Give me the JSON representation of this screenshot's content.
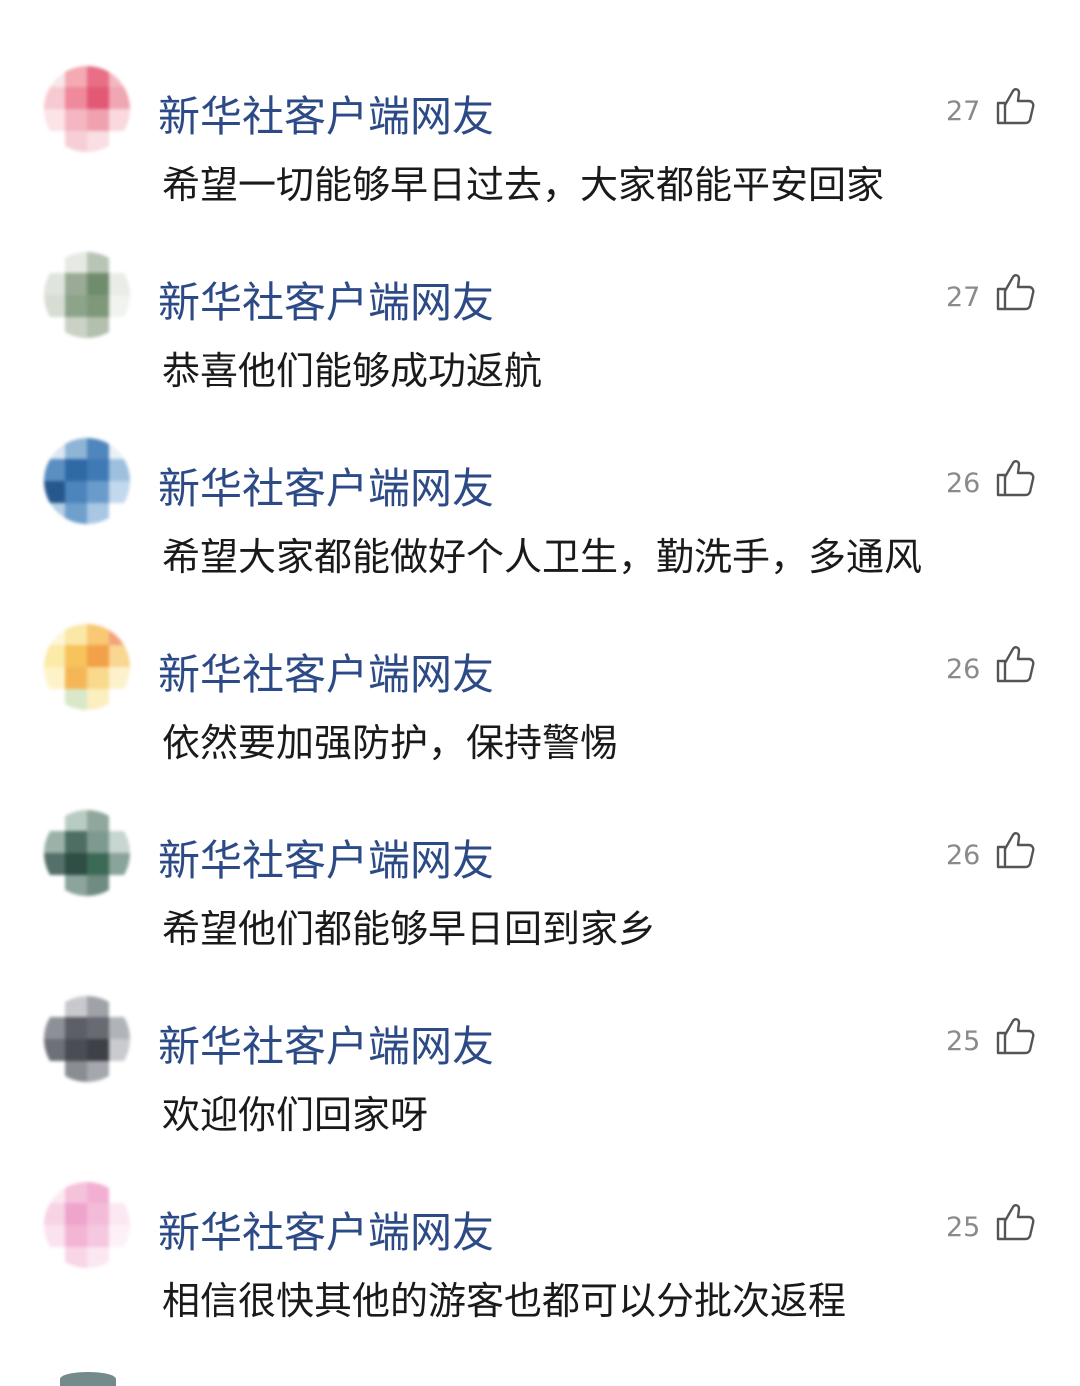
{
  "comments": [
    {
      "username": "新华社客户端网友",
      "text": "希望一切能够早日过去，大家都能平安回家",
      "likes": "27",
      "avatar_colors": [
        "#f8e7e8",
        "#f4a9b3",
        "#e86f85",
        "#f3b7c0",
        "#f7c9d0",
        "#ee8a9c",
        "#e25875",
        "#f0a6b3",
        "#fbe3e6",
        "#f5b6c1",
        "#f0a1b0",
        "#f9d9de",
        "#ffffff",
        "#f6cfd6",
        "#f9dee3",
        "#ffffff"
      ]
    },
    {
      "username": "新华社客户端网友",
      "text": "恭喜他们能够成功返航",
      "likes": "27",
      "avatar_colors": [
        "#ffffff",
        "#e6e9e4",
        "#b8c4b4",
        "#ffffff",
        "#dfe4dc",
        "#9aaa96",
        "#6f8c6d",
        "#e9ece7",
        "#d7ddd3",
        "#8da38a",
        "#7e9879",
        "#f1f3ef",
        "#ffffff",
        "#c9d2c4",
        "#b3c0ae",
        "#ffffff"
      ]
    },
    {
      "username": "新华社客户端网友",
      "text": "希望大家都能做好个人卫生，勤洗手，多通风",
      "likes": "26",
      "avatar_colors": [
        "#dbe7f2",
        "#8fb4d6",
        "#4f86bd",
        "#e9f1f8",
        "#5b8fc2",
        "#2f6aa6",
        "#3f7ab4",
        "#9dc0df",
        "#26588e",
        "#4c84bc",
        "#6a9ccb",
        "#c2d8ec",
        "#b5cde5",
        "#6f9fcc",
        "#a9c7e3",
        "#ffffff"
      ]
    },
    {
      "username": "新华社客户端网友",
      "text": "依然要加强防护，保持警惕",
      "likes": "26",
      "avatar_colors": [
        "#fdf6d8",
        "#fbe7a6",
        "#f8c874",
        "#f3a37c",
        "#fbeaa8",
        "#f6c35c",
        "#f2a149",
        "#f9d691",
        "#fef3c8",
        "#f5b756",
        "#f9d98c",
        "#fdf1cc",
        "#ffffff",
        "#d9e8c8",
        "#fbefc0",
        "#ffffff"
      ]
    },
    {
      "username": "新华社客户端网友",
      "text": "希望他们都能够早日回到家乡",
      "likes": "26",
      "avatar_colors": [
        "#ffffff",
        "#b9ccc3",
        "#8fa89b",
        "#ffffff",
        "#9bb2a9",
        "#4e6e63",
        "#7e9a90",
        "#c7d6d0",
        "#556f69",
        "#2f4e45",
        "#3b6a55",
        "#8aa39b",
        "#ffffff",
        "#8ca49c",
        "#6f8b82",
        "#ffffff"
      ]
    },
    {
      "username": "新华社客户端网友",
      "text": "欢迎你们回家呀",
      "likes": "25",
      "avatar_colors": [
        "#ffffff",
        "#c8c9cc",
        "#9fa2a7",
        "#ffffff",
        "#8d9096",
        "#5c5f66",
        "#686b72",
        "#b0b3b8",
        "#6d7077",
        "#4a4d54",
        "#3e4148",
        "#c9cbce",
        "#ffffff",
        "#8a8d93",
        "#a4a7ac",
        "#ffffff"
      ]
    },
    {
      "username": "新华社客户端网友",
      "text": "相信很快其他的游客也都可以分批次返程",
      "likes": "25",
      "avatar_colors": [
        "#fbe9f2",
        "#f5c2dc",
        "#f1b0d2",
        "#ffffff",
        "#f7d3e6",
        "#eea4cb",
        "#f3bbd8",
        "#fce8f2",
        "#fae3ef",
        "#f2b5d4",
        "#f5c8df",
        "#fdf1f7",
        "#ffffff",
        "#f8d6e8",
        "#fbe7f1",
        "#ffffff"
      ]
    }
  ],
  "icons": {
    "like": "thumbs-up-icon"
  }
}
